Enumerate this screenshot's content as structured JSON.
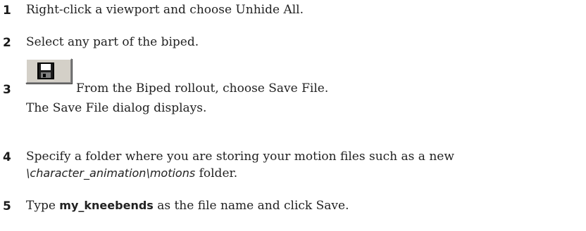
{
  "steps": [
    {
      "number": "1",
      "text": "Right-click a viewport and choose Unhide All."
    },
    {
      "number": "2",
      "text": "Select any part of the biped."
    },
    {
      "number": "3",
      "icon": "save-file-icon",
      "text": "From the Biped rollout, choose Save File.",
      "result": "The Save File dialog displays."
    },
    {
      "number": "4",
      "line1": "Specify a folder where you are storing your motion files such as a new",
      "path": "\\character_animation\\motions",
      "line2_suffix": " folder."
    },
    {
      "number": "5",
      "prefix": "Type ",
      "bold": "my_kneebends",
      "suffix": " as the file name and click Save."
    }
  ]
}
